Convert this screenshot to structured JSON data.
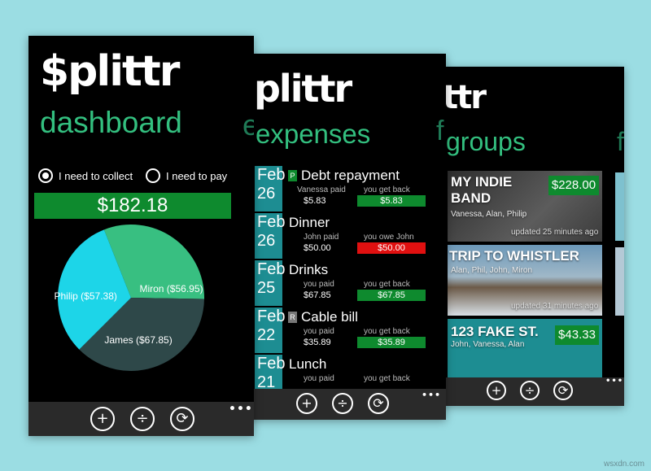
{
  "app": {
    "logo_full": "$plittr",
    "logo_crop2": "plittr",
    "logo_crop3": "ttr"
  },
  "colors": {
    "accent": "#33bf7f",
    "total_bg": "#0e8a2e",
    "owe": "#e01010",
    "date_tile": "#1d8d92",
    "background": "#9bdde3"
  },
  "dashboard": {
    "title": "dashboard",
    "peek_title": "e",
    "radio_collect": "I need to collect",
    "radio_pay": "I need to pay",
    "total": "$182.18",
    "slices": [
      {
        "label": "Miron  ($56.95)",
        "value": 56.95,
        "color": "#38bf81"
      },
      {
        "label": "James  ($67.85)",
        "value": 67.85,
        "color": "#2e4849"
      },
      {
        "label": "Philip  ($57.38)",
        "value": 57.38,
        "color": "#1dd5e8"
      }
    ]
  },
  "expenses": {
    "title": "expenses",
    "peek_title": "f",
    "items": [
      {
        "month": "Feb",
        "day": "26",
        "tag": "P",
        "title": "Debt repayment",
        "who": "Vanessa paid",
        "paid": "$5.83",
        "status": "you get back",
        "amount": "$5.83",
        "color": "#0e8a2e"
      },
      {
        "month": "Feb",
        "day": "26",
        "tag": "",
        "title": "Dinner",
        "who": "John paid",
        "paid": "$50.00",
        "status": "you owe John",
        "amount": "$50.00",
        "color": "#e01010"
      },
      {
        "month": "Feb",
        "day": "25",
        "tag": "",
        "title": "Drinks",
        "who": "you paid",
        "paid": "$67.85",
        "status": "you get back",
        "amount": "$67.85",
        "color": "#0e8a2e"
      },
      {
        "month": "Feb",
        "day": "22",
        "tag": "R",
        "title": "Cable bill",
        "who": "you paid",
        "paid": "$35.89",
        "status": "you get back",
        "amount": "$35.89",
        "color": "#0e8a2e"
      },
      {
        "month": "Feb",
        "day": "21",
        "tag": "",
        "title": "Lunch",
        "who": "you paid",
        "paid": "",
        "status": "you get back",
        "amount": "",
        "color": "#0e8a2e"
      }
    ]
  },
  "groups": {
    "title": "groups",
    "peek_title": "f",
    "items": [
      {
        "name": "MY INDIE BAND",
        "members": "Vanessa, Alan, Philip",
        "amount": "$228.00",
        "updated": "updated 25 minutes ago"
      },
      {
        "name": "TRIP TO WHISTLER",
        "members": "Alan, Phil, John, Miron",
        "amount": "",
        "updated": "updated 31 minutes ago"
      },
      {
        "name": "123 FAKE ST.",
        "members": "John, Vanessa, Alan",
        "amount": "$43.33",
        "updated": ""
      }
    ]
  },
  "appbar": {
    "add_glyph": "+",
    "split_glyph": "÷",
    "sync_glyph": "⟳",
    "more_glyph": "•••"
  },
  "watermark": "wsxdn.com"
}
